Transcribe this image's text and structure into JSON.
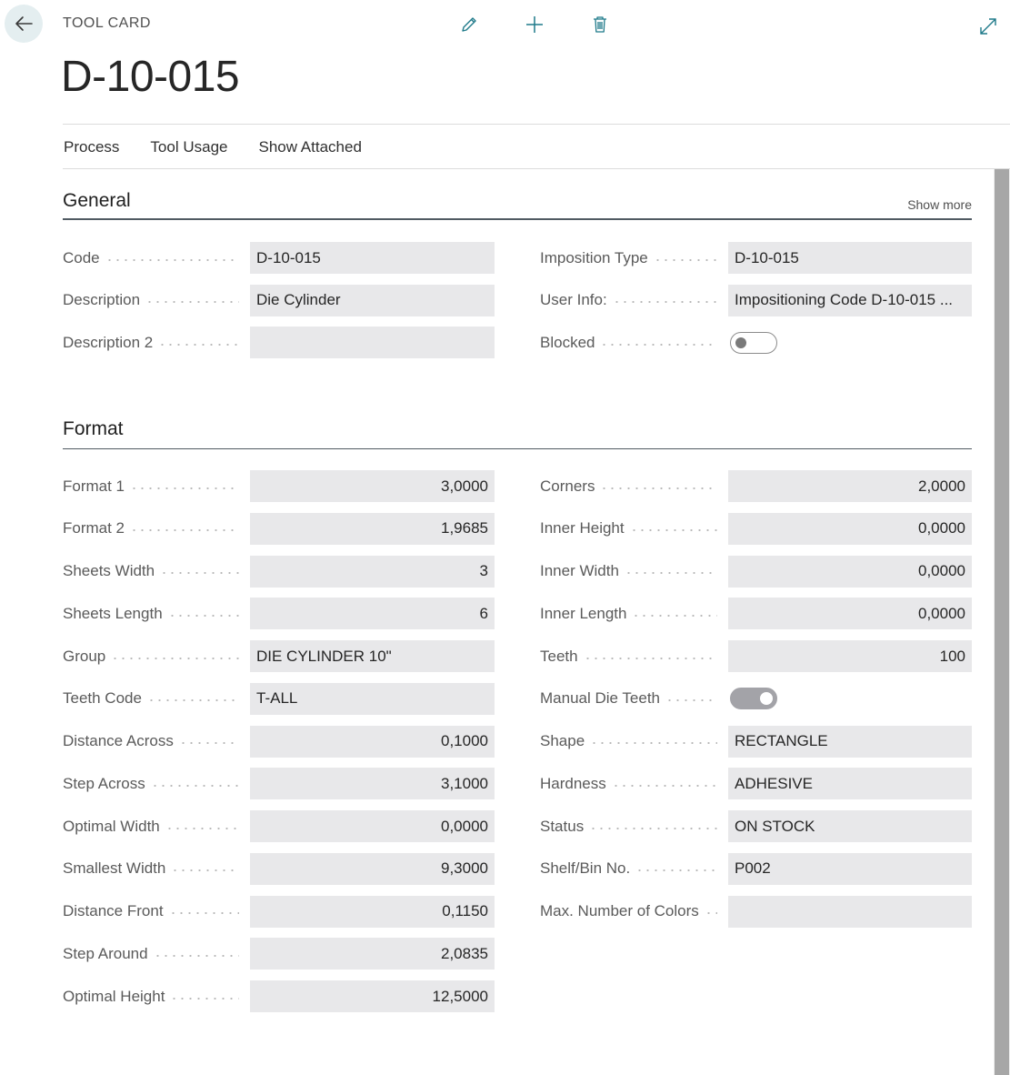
{
  "header": {
    "caption": "TOOL CARD",
    "record_title": "D-10-015"
  },
  "icons": {
    "back": "arrow-left-icon",
    "edit": "pencil-icon",
    "new": "plus-icon",
    "delete": "trash-icon",
    "expand": "expand-icon"
  },
  "menu": {
    "items": [
      {
        "label": "Process"
      },
      {
        "label": "Tool Usage"
      },
      {
        "label": "Show Attached"
      }
    ]
  },
  "general": {
    "title": "General",
    "show_more": "Show more",
    "left": [
      {
        "label": "Code",
        "value": "D-10-015"
      },
      {
        "label": "Description",
        "value": "Die Cylinder"
      },
      {
        "label": "Description 2",
        "value": ""
      }
    ],
    "right": [
      {
        "label": "Imposition Type",
        "value": "D-10-015"
      },
      {
        "label": "User Info:",
        "value": "Impositioning Code D-10-015 ..."
      },
      {
        "label": "Blocked",
        "toggle": false
      }
    ]
  },
  "format": {
    "title": "Format",
    "left": [
      {
        "label": "Format 1",
        "value": "3,0000"
      },
      {
        "label": "Format 2",
        "value": "1,9685"
      },
      {
        "label": "Sheets Width",
        "value": "3"
      },
      {
        "label": "Sheets Length",
        "value": "6"
      },
      {
        "label": "Group",
        "value": "DIE CYLINDER 10\""
      },
      {
        "label": "Teeth Code",
        "value": "T-ALL"
      },
      {
        "label": "Distance Across",
        "value": "0,1000"
      },
      {
        "label": "Step Across",
        "value": "3,1000"
      },
      {
        "label": "Optimal Width",
        "value": "0,0000"
      },
      {
        "label": "Smallest Width",
        "value": "9,3000"
      },
      {
        "label": "Distance Front",
        "value": "0,1150"
      },
      {
        "label": "Step Around",
        "value": "2,0835"
      },
      {
        "label": "Optimal Height",
        "value": "12,5000"
      }
    ],
    "right": [
      {
        "label": "Corners",
        "value": "2,0000"
      },
      {
        "label": "Inner Height",
        "value": "0,0000"
      },
      {
        "label": "Inner Width",
        "value": "0,0000"
      },
      {
        "label": "Inner Length",
        "value": "0,0000"
      },
      {
        "label": "Teeth",
        "value": "100"
      },
      {
        "label": "Manual Die Teeth",
        "toggle": true
      },
      {
        "label": "Shape",
        "value": "RECTANGLE"
      },
      {
        "label": "Hardness",
        "value": "ADHESIVE"
      },
      {
        "label": "Status",
        "value": "ON STOCK"
      },
      {
        "label": "Shelf/Bin No.",
        "value": "P002"
      },
      {
        "label": "Max. Number of Colors",
        "value": ""
      }
    ]
  }
}
